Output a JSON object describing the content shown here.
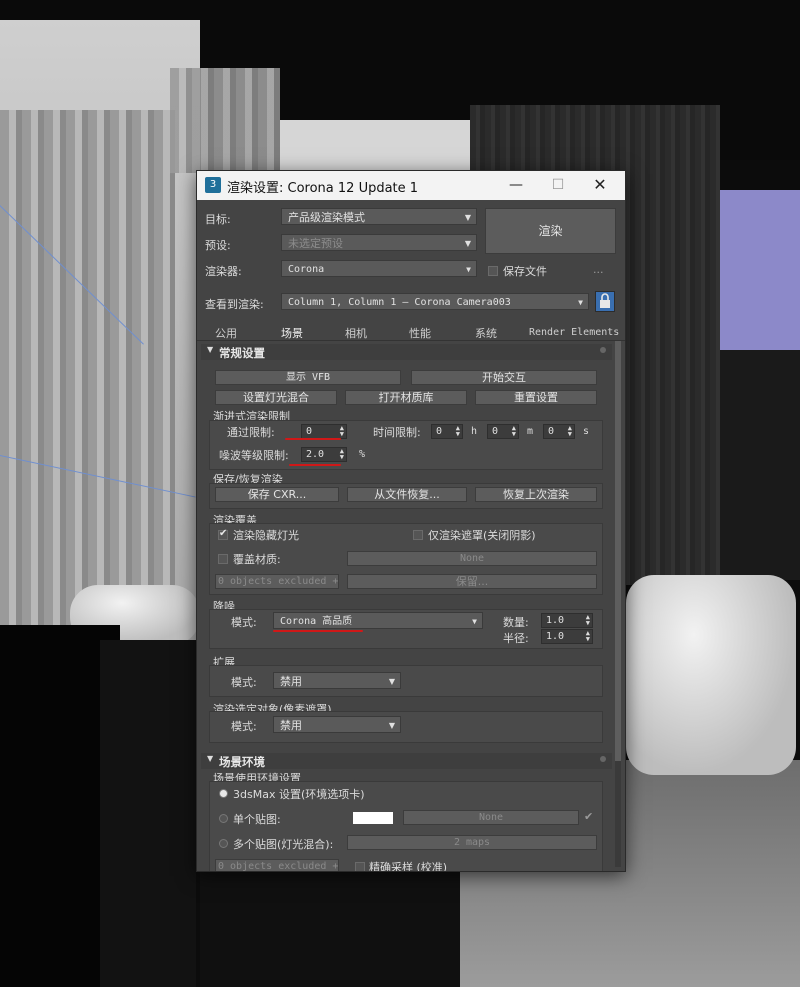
{
  "window": {
    "title": "渲染设置: Corona 12 Update 1",
    "minimize": "—",
    "maximize": "☐",
    "close": "✕"
  },
  "top": {
    "target_label": "目标:",
    "target_value": "产品级渲染模式",
    "preset_label": "预设:",
    "preset_value": "未选定预设",
    "renderer_label": "渲染器:",
    "renderer_value": "Corona",
    "save_file_label": "保存文件",
    "more": "...",
    "render_button": "渲染",
    "view_label": "查看到渲染:",
    "view_value": "Column 1, Column 1 — Corona Camera003"
  },
  "tabs": [
    "公用",
    "场景",
    "相机",
    "性能",
    "系统",
    "Render Elements"
  ],
  "general": {
    "title": "常规设置",
    "btn_vfb": "显示 VFB",
    "btn_interactive": "开始交互",
    "btn_lightmix": "设置灯光混合",
    "btn_matlib": "打开材质库",
    "btn_reset": "重置设置",
    "progressive_title": "渐进式渲染限制",
    "pass_limit_label": "通过限制:",
    "pass_limit_value": "0",
    "time_limit_label": "时间限制:",
    "time_h": "0",
    "h": "h",
    "time_m": "0",
    "m": "m",
    "time_s": "0",
    "s": "s",
    "noise_label": "噪波等级限制:",
    "noise_value": "2.0",
    "percent": "%",
    "save_restore_title": "保存/恢复渲染",
    "btn_save_cxr": "保存 CXR...",
    "btn_restore_file": "从文件恢复...",
    "btn_restore_last": "恢复上次渲染",
    "override_title": "渲染覆盖",
    "render_hidden_lights": "渲染隐藏灯光",
    "render_mask_only": "仅渲染遮罩(关闭阴影)",
    "override_material": "覆盖材质:",
    "override_material_value": "None",
    "objects_excluded": "0 objects excluded +",
    "keep": "保留...",
    "denoise_title": "降噪",
    "mode_label": "模式:",
    "denoise_mode": "Corona 高品质",
    "amount_label": "数量:",
    "amount_value": "1.0",
    "radius_label": "半径:",
    "radius_value": "1.0",
    "extend_title": "扩展",
    "extend_mode": "禁用",
    "selected_title": "渲染选定对象(像素遮罩)",
    "selected_mode": "禁用"
  },
  "scene_env": {
    "title": "场景环境",
    "subtitle": "场景使用环境设置",
    "opt_3dsmax": "3dsMax 设置(环境选项卡)",
    "opt_single": "单个贴图:",
    "single_map_value": "None",
    "opt_multi": "多个贴图(灯光混合):",
    "multi_value": "2 maps",
    "objects_excluded": "0 objects excluded +",
    "precise_sampling": "精确采样 (校准)"
  }
}
